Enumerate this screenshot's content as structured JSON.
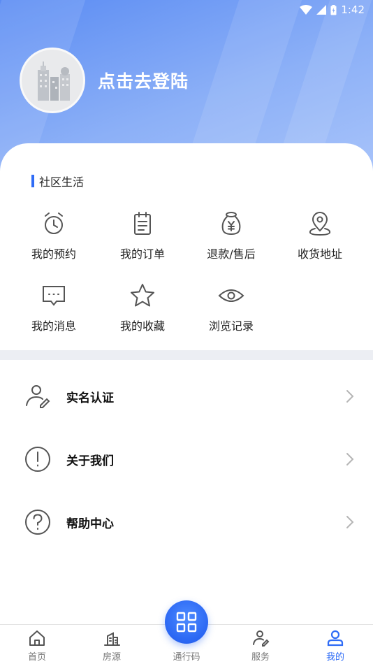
{
  "status_bar": {
    "time": "1:42"
  },
  "profile": {
    "login_prompt": "点击去登陆"
  },
  "community": {
    "title": "社区生活",
    "items": [
      {
        "label": "我的预约",
        "icon": "alarm-clock-icon"
      },
      {
        "label": "我的订单",
        "icon": "clipboard-icon"
      },
      {
        "label": "退款/售后",
        "icon": "money-bag-icon"
      },
      {
        "label": "收货地址",
        "icon": "location-pin-icon"
      },
      {
        "label": "我的消息",
        "icon": "message-icon"
      },
      {
        "label": "我的收藏",
        "icon": "star-icon"
      },
      {
        "label": "浏览记录",
        "icon": "eye-icon"
      }
    ]
  },
  "menu": [
    {
      "label": "实名认证",
      "icon": "user-edit-icon"
    },
    {
      "label": "关于我们",
      "icon": "info-circle-icon"
    },
    {
      "label": "帮助中心",
      "icon": "help-circle-icon"
    }
  ],
  "tabbar": {
    "tabs": [
      {
        "label": "首页",
        "icon": "home-icon"
      },
      {
        "label": "房源",
        "icon": "building-icon"
      },
      {
        "label": "通行码",
        "icon": "qr-code-icon"
      },
      {
        "label": "服务",
        "icon": "service-user-icon"
      },
      {
        "label": "我的",
        "icon": "profile-icon"
      }
    ],
    "active": "我的"
  },
  "colors": {
    "accent": "#2f6cf6",
    "header_top": "#5b8cf3",
    "header_bottom": "#a9c4fa",
    "icon_gray": "#555555"
  }
}
